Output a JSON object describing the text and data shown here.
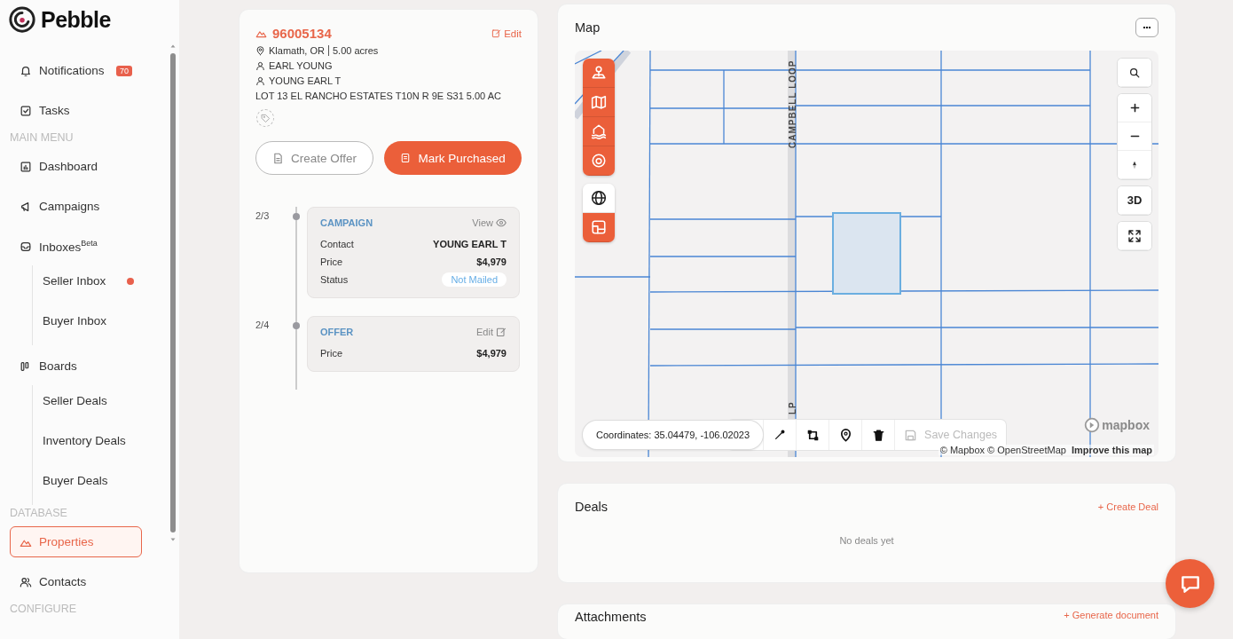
{
  "sidebar": {
    "logo": "Pebble",
    "items": [
      {
        "kind": "item",
        "label": "Notifications",
        "badge": "70",
        "selected": false
      },
      {
        "kind": "item",
        "label": "Tasks",
        "selected": false
      },
      {
        "kind": "section",
        "label": "MAIN MENU"
      },
      {
        "kind": "item",
        "label": "Dashboard",
        "selected": false
      },
      {
        "kind": "item",
        "label": "Campaigns",
        "selected": false
      },
      {
        "kind": "item",
        "label": "Inboxes$^{Beta}$",
        "selected": false,
        "children": [
          {
            "label": "Seller Inbox",
            "selected": false,
            "color": "#e8604c"
          },
          {
            "label": "Buyer Inbox",
            "selected": false
          }
        ]
      },
      {
        "kind": "item",
        "label": "Boards",
        "selected": false,
        "children": [
          {
            "label": "Seller Deals",
            "selected": false
          },
          {
            "label": "Inventory Deals",
            "selected": false
          },
          {
            "label": "Buyer Deals",
            "selected": false
          }
        ]
      },
      {
        "kind": "section",
        "label": "DATABASE"
      },
      {
        "kind": "item",
        "label": "Properties",
        "selected": true
      },
      {
        "kind": "item",
        "label": "Contacts",
        "selected": false
      },
      {
        "kind": "section",
        "label": "CONFIGURE"
      }
    ]
  },
  "property": {
    "id": "96005134",
    "edit": "Edit",
    "location": "Klamath, OR",
    "acreage": "5.00 acres",
    "owners": [
      "EARL YOUNG",
      "YOUNG EARL T"
    ],
    "legal": "LOT 13 EL RANCHO ESTATES T10N R 9E S31 5.00 AC",
    "buttons": [
      {
        "label": "Create Offer",
        "kind": "secondary"
      },
      {
        "label": "Mark Purchased",
        "kind": "primary"
      }
    ],
    "timeline": [
      {
        "step": "2/3",
        "title": "CAMPAIGN",
        "action": "View",
        "kind": "view",
        "rows": [
          {
            "label": "Contact",
            "value": "YOUNG EARL T",
            "kind": "text"
          },
          {
            "label": "Price",
            "value": "$4,979",
            "kind": "text"
          },
          {
            "label": "Status",
            "value": "Not Mailed",
            "kind": "status"
          }
        ]
      },
      {
        "step": "2/4",
        "title": "OFFER",
        "action": "Edit",
        "kind": "edit",
        "rows": [
          {
            "label": "Price",
            "value": "$4,979",
            "kind": "text"
          }
        ]
      }
    ]
  },
  "map": {
    "title": "Map",
    "layers": [
      {
        "on": true
      },
      {
        "on": true
      },
      {
        "on": true
      },
      {
        "on": true
      }
    ],
    "basemaps": [
      {
        "selected": false
      },
      {
        "selected": true
      }
    ],
    "three_d": "3D",
    "streets": [
      "CAMPBELL LOOP",
      "LP"
    ],
    "logo": "mapbox",
    "attribution": "© Mapbox © OpenStreetMap",
    "improve": "Improve this map",
    "coordinates": "Coordinates: 35.04479, -106.02023",
    "save": {
      "label": "Save Changes",
      "disabled": true
    }
  },
  "deals": {
    "title": "Deals",
    "action": "+ Create Deal",
    "empty": "No deals yet"
  },
  "attachments": {
    "title": "Attachments",
    "action": "+ Generate document"
  }
}
